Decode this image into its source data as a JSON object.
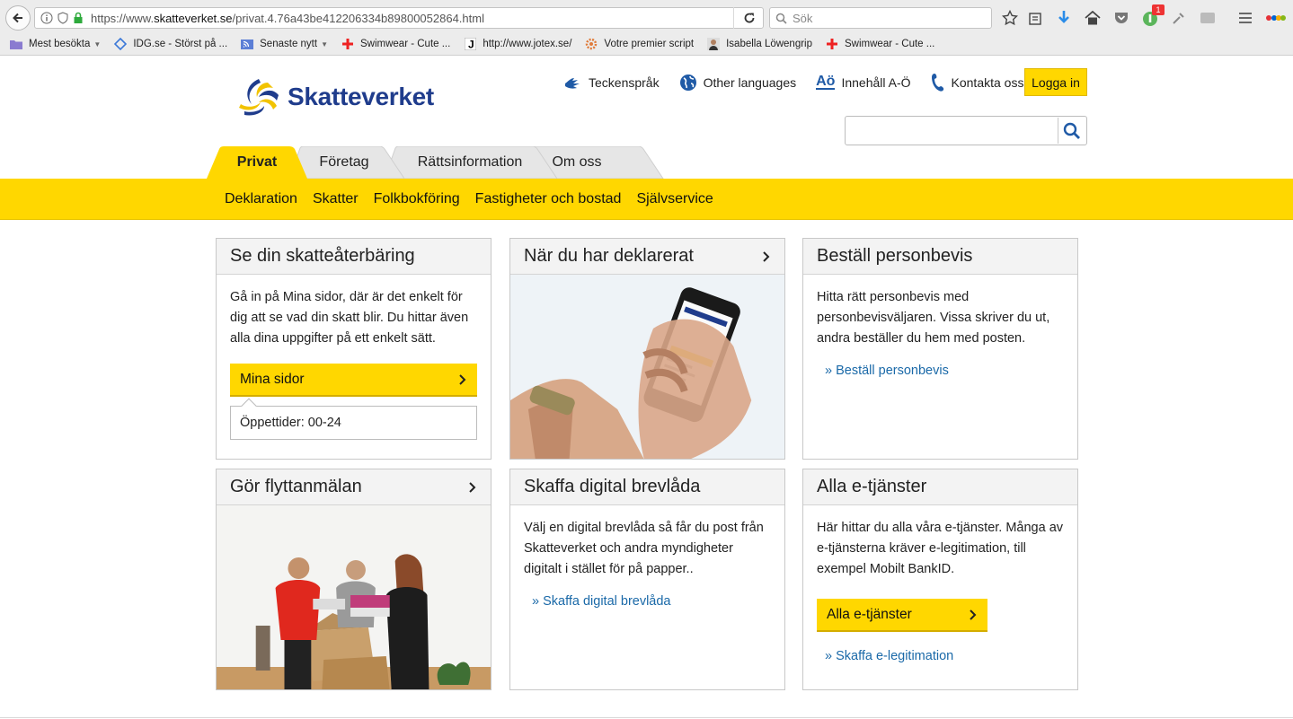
{
  "browser": {
    "url_prefix": "https://www.",
    "url_host": "skatteverket.se",
    "url_path": "/privat.4.76a43be412206334b89800052864.html",
    "search_placeholder": "Sök",
    "badge_count": "1",
    "bookmarks": [
      {
        "label": "Mest besökta",
        "icon": "folder-icon",
        "dropdown": true
      },
      {
        "label": "IDG.se - Störst på ...",
        "icon": "idg-icon",
        "dropdown": false
      },
      {
        "label": "Senaste nytt",
        "icon": "rss-icon",
        "dropdown": true
      },
      {
        "label": "Swimwear - Cute ...",
        "icon": "red-cross-icon",
        "dropdown": false
      },
      {
        "label": "http://www.jotex.se/",
        "icon": "j-icon",
        "dropdown": false
      },
      {
        "label": "Votre premier script",
        "icon": "gear-icon",
        "dropdown": false
      },
      {
        "label": "Isabella Löwengrip",
        "icon": "person-icon",
        "dropdown": false
      },
      {
        "label": "Swimwear - Cute ...",
        "icon": "red-cross-icon",
        "dropdown": false
      }
    ]
  },
  "site": {
    "logo_text": "Skatteverket",
    "util_nav": {
      "sign_language": "Teckenspråk",
      "other_languages": "Other languages",
      "az_icon_text": "Aö",
      "content_az": "Innehåll A-Ö",
      "contact": "Kontakta oss"
    },
    "login": "Logga in",
    "search_value": ""
  },
  "tabs": [
    "Privat",
    "Företag",
    "Rättsinformation",
    "Om oss"
  ],
  "subnav": [
    "Deklaration",
    "Skatter",
    "Folkbokföring",
    "Fastigheter och bostad",
    "Självservice"
  ],
  "cards": {
    "refund": {
      "title": "Se din skatteåterbäring",
      "text": "Gå in på Mina sidor, där är det enkelt för dig att se vad din skatt blir. Du hittar även alla dina uppgifter på ett enkelt sätt.",
      "button": "Mina sidor",
      "hours": "Öppettider: 00-24"
    },
    "declared": {
      "title": "När du har deklarerat"
    },
    "certificate": {
      "title": "Beställ personbevis",
      "text": "Hitta rätt personbevis med personbevisväljaren. Vissa skriver du ut, andra beställer du hem med posten.",
      "link": "» Beställ personbevis"
    },
    "move": {
      "title": "Gör flyttanmälan"
    },
    "mailbox": {
      "title": "Skaffa digital brevlåda",
      "text": "Välj en digital brevlåda så får du post från Skatteverket och andra myndigheter digitalt i stället för på papper..",
      "link": "» Skaffa digital brevlåda"
    },
    "eservices": {
      "title": "Alla e-tjänster",
      "text": "Här hittar du alla våra e-tjänster. Många av e-tjänsterna kräver e-legitimation, till exempel Mobilt BankID.",
      "button": "Alla e-tjänster",
      "link": "» Skaffa e-legitimation"
    }
  },
  "colors": {
    "brand_yellow": "#ffd700",
    "brand_blue": "#1f3c8c",
    "link_blue": "#1a69a8"
  }
}
